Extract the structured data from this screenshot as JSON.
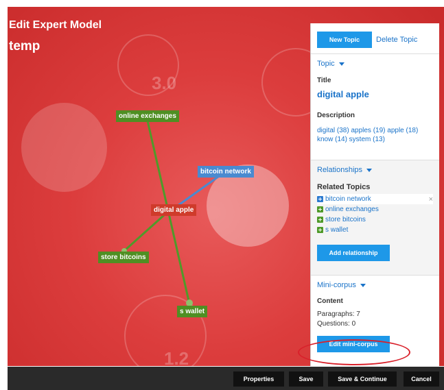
{
  "header": {
    "title": "Edit Expert Model",
    "model_name": "temp"
  },
  "graph": {
    "nodes": {
      "online_exchanges": "online exchanges",
      "bitcoin_network": "bitcoin network",
      "digital_apple": "digital apple",
      "store_bitcoins": "store bitcoins",
      "s_wallet": "s wallet"
    },
    "background_numbers": [
      "3.0",
      "1.2"
    ],
    "colors": {
      "link_green": "#4f9a2a",
      "link_blue": "#4a8ad0",
      "center": "#cf3b2b"
    }
  },
  "panel": {
    "new_topic": "New Topic",
    "delete_topic": "Delete Topic",
    "topic": {
      "header": "Topic",
      "title_label": "Title",
      "title_value": "digital apple",
      "description_label": "Description",
      "description_value": "digital (38) apples (19) apple (18) know (14) system (13)"
    },
    "relationships": {
      "header": "Relationships",
      "related_label": "Related Topics",
      "items": [
        "bitcoin network",
        "online exchanges",
        "store bitcoins",
        "s wallet"
      ],
      "add_button": "Add relationship"
    },
    "mini_corpus": {
      "header": "Mini-corpus",
      "content_label": "Content",
      "paragraphs": "Paragraphs: 7",
      "questions": "Questions: 0",
      "edit_button": "Edit mini-corpus"
    }
  },
  "footer": {
    "properties": "Properties",
    "save": "Save",
    "save_continue": "Save & Continue",
    "cancel": "Cancel"
  },
  "colors": {
    "accent": "#1e98e8",
    "highlight": "#d9202a"
  }
}
